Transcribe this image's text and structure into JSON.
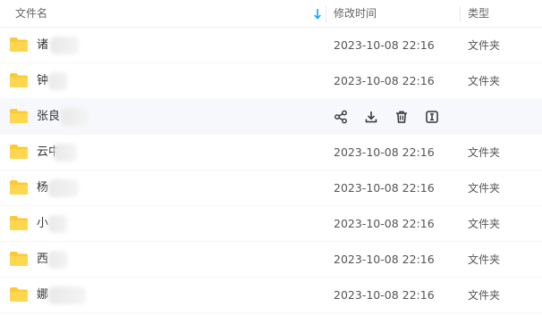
{
  "header": {
    "name_label": "文件名",
    "modified_label": "修改时间",
    "type_label": "类型",
    "sort_icon": "sort-down-arrow-icon"
  },
  "rows": [
    {
      "name": "诸",
      "modified": "2023-10-08 22:16",
      "type": "文件夹"
    },
    {
      "name": "钟",
      "modified": "2023-10-08 22:16",
      "type": "文件夹"
    },
    {
      "name": "张良",
      "modified": "",
      "type": ""
    },
    {
      "name": "云中",
      "modified": "2023-10-08 22:16",
      "type": "文件夹"
    },
    {
      "name": "杨",
      "modified": "2023-10-08 22:16",
      "type": "文件夹"
    },
    {
      "name": "小",
      "modified": "2023-10-08 22:16",
      "type": "文件夹"
    },
    {
      "name": "西",
      "modified": "2023-10-08 22:16",
      "type": "文件夹"
    },
    {
      "name": "娜",
      "modified": "2023-10-08 22:16",
      "type": "文件夹"
    }
  ],
  "hover_actions": [
    "share-icon",
    "download-icon",
    "delete-icon",
    "rename-icon"
  ],
  "colors": {
    "folder_yellow": "#FFC933",
    "accent_blue": "#06a7ff",
    "hover_bg": "#f6f8fb"
  }
}
